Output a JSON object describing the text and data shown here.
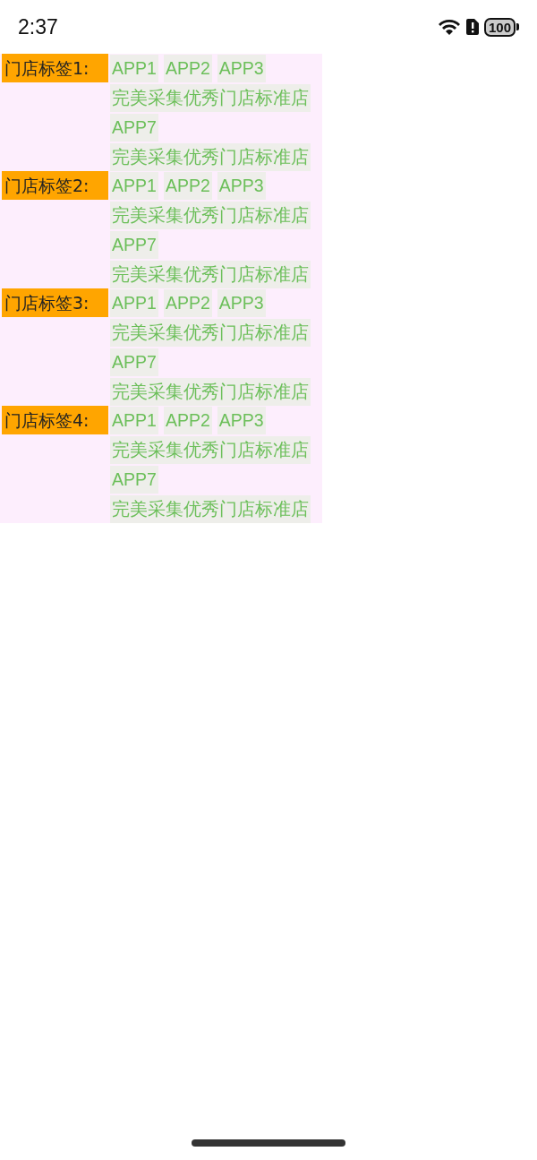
{
  "status_bar": {
    "time": "2:37",
    "battery": "100"
  },
  "groups": [
    {
      "label": "门店标签1:",
      "tags": [
        "APP1",
        "APP2",
        "APP3",
        "完美采集优秀门店标准店",
        "APP7",
        "完美采集优秀门店标准店"
      ]
    },
    {
      "label": "门店标签2:",
      "tags": [
        "APP1",
        "APP2",
        "APP3",
        "完美采集优秀门店标准店",
        "APP7",
        "完美采集优秀门店标准店"
      ]
    },
    {
      "label": "门店标签3:",
      "tags": [
        "APP1",
        "APP2",
        "APP3",
        "完美采集优秀门店标准店",
        "APP7",
        "完美采集优秀门店标准店"
      ]
    },
    {
      "label": "门店标签4:",
      "tags": [
        "APP1",
        "APP2",
        "APP3",
        "完美采集优秀门店标准店",
        "APP7",
        "完美采集优秀门店标准店"
      ]
    }
  ]
}
